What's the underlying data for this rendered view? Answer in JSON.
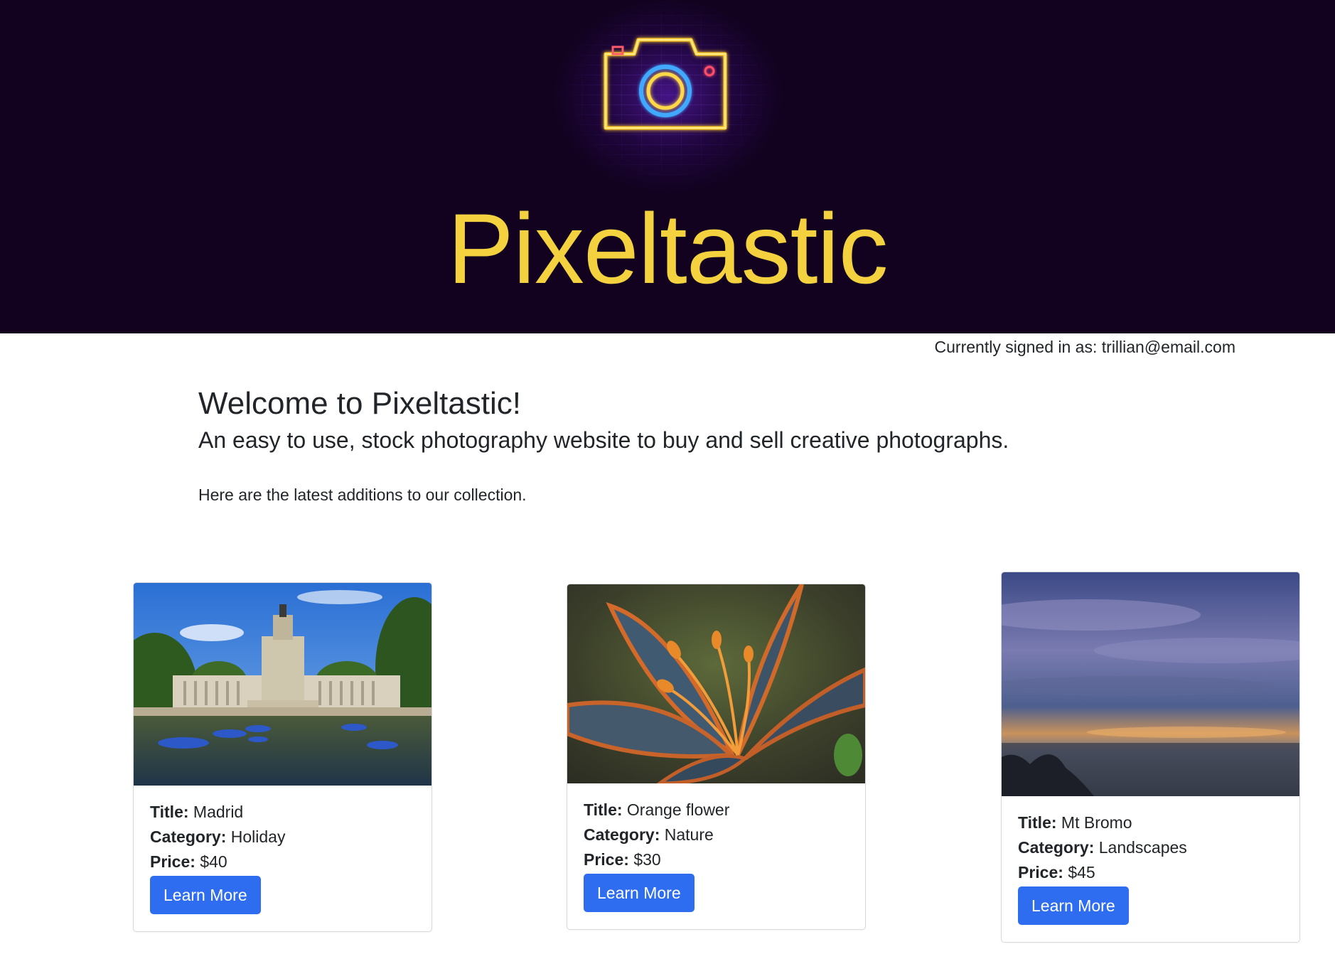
{
  "header": {
    "logo_icon": "neon-camera-icon",
    "brand_title": "Pixeltastic",
    "background_color": "#12021f",
    "title_color": "#f4d23f"
  },
  "user": {
    "signed_in_label": "Currently signed in as:",
    "email": "trillian@email.com"
  },
  "intro": {
    "welcome": "Welcome to Pixeltastic!",
    "tagline": "An easy to use, stock photography website to buy and sell creative photographs.",
    "latest_text": "Here are the latest additions to our collection."
  },
  "labels": {
    "title": "Title:",
    "category": "Category:",
    "price": "Price:"
  },
  "photos": [
    {
      "title": "Madrid",
      "category": "Holiday",
      "price": "$40",
      "button_label": "Learn More",
      "image_subject": "madrid-park-monument-lake-photo"
    },
    {
      "title": "Orange flower",
      "category": "Nature",
      "price": "$30",
      "button_label": "Learn More",
      "image_subject": "orange-lily-flower-photo"
    },
    {
      "title": "Mt Bromo",
      "category": "Landscapes",
      "price": "$45",
      "button_label": "Learn More",
      "image_subject": "mt-bromo-sunrise-clouds-photo"
    }
  ],
  "colors": {
    "button": "#2f6df0",
    "text": "#212529"
  }
}
